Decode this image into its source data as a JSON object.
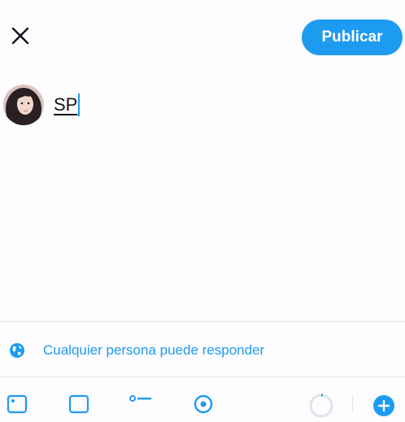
{
  "header": {
    "close_icon": "close-icon",
    "publish_label": "Publicar",
    "accent_color": "#1d9bf0"
  },
  "composer": {
    "text": "SP",
    "avatar_icon": "profile-photo"
  },
  "reply_setting": {
    "icon": "globe-icon",
    "label": "Cualquier persona puede responder"
  },
  "toolbar": {
    "icons": [
      "image-icon",
      "gif-icon",
      "poll-icon",
      "location-icon",
      "progress-circle-icon",
      "add-icon"
    ]
  }
}
